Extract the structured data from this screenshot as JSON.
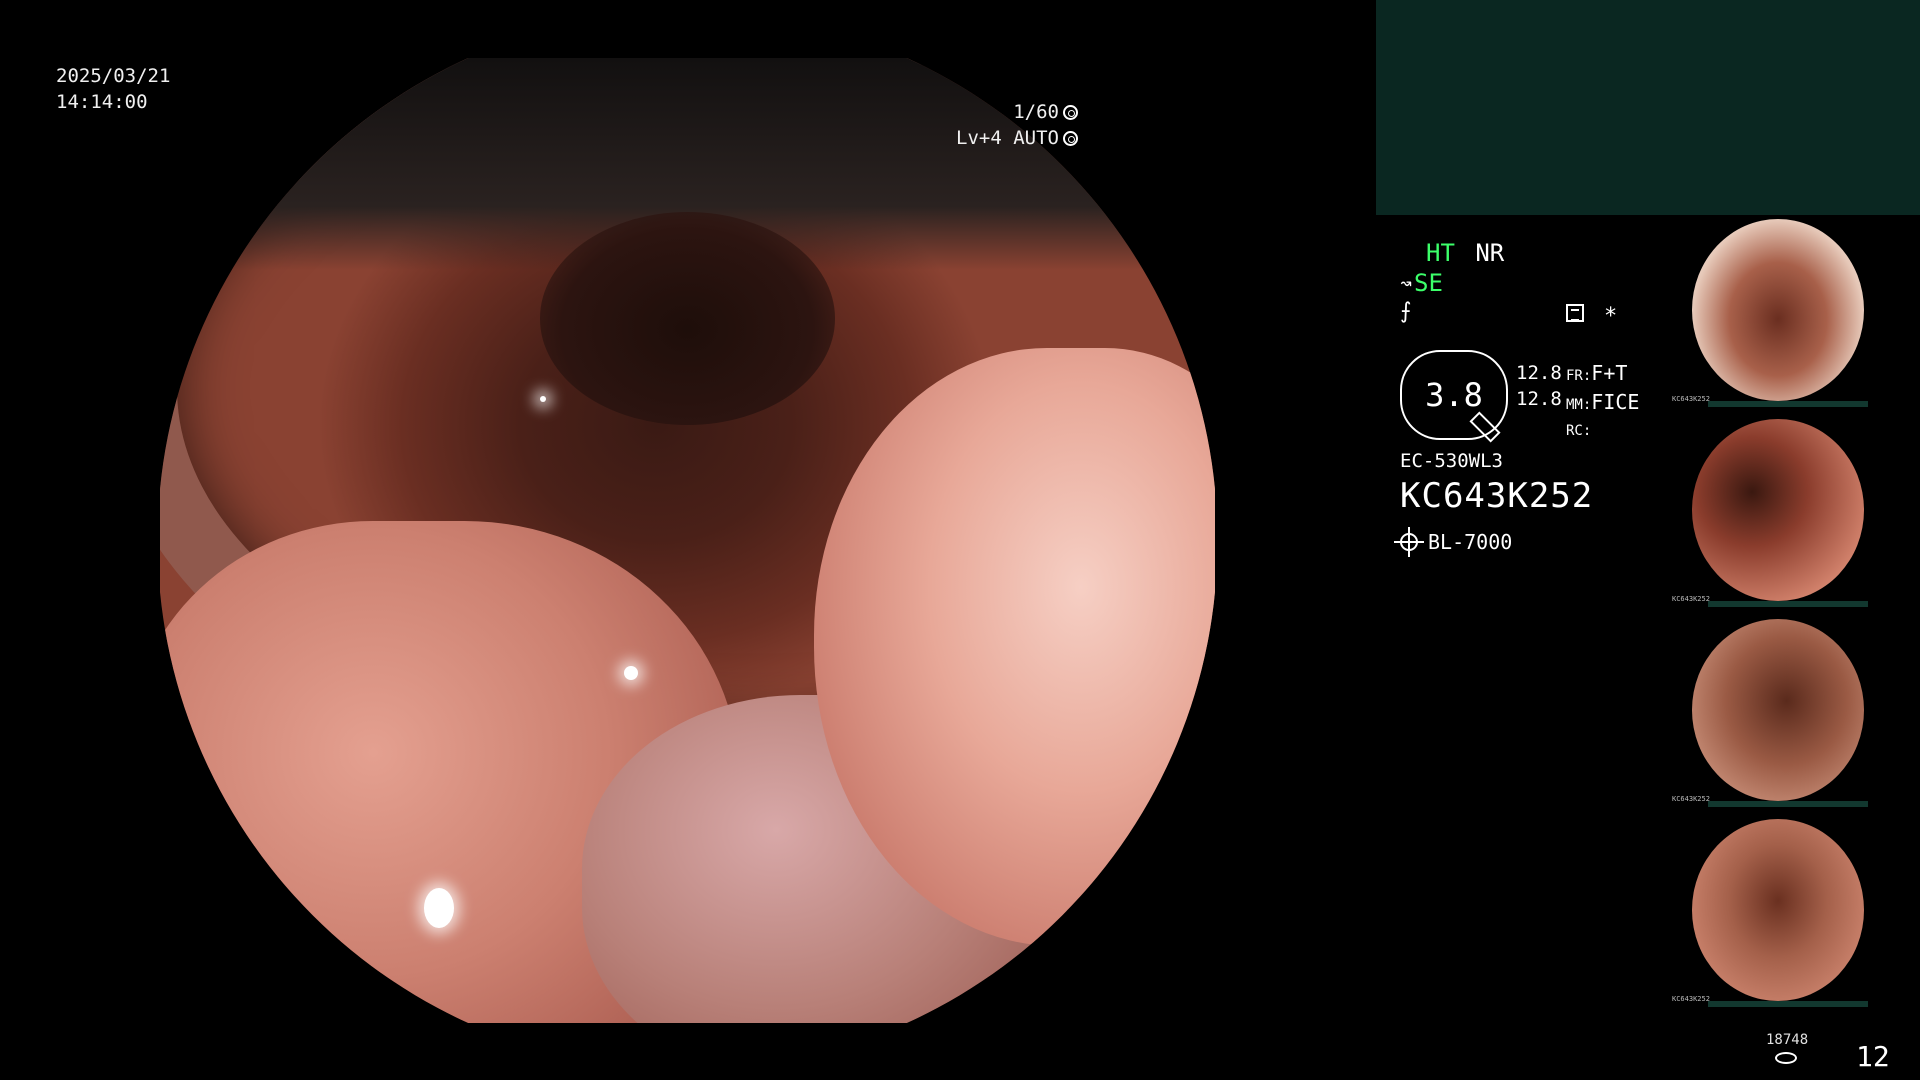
{
  "overlay": {
    "date": "2025/03/21",
    "time": "14:14:00",
    "shutter": "1/60",
    "level": "Lv+4 AUTO"
  },
  "status": {
    "ht": "HT",
    "nr": "NR",
    "se": "SE",
    "gauge_value": "3.8",
    "val1": "12.8",
    "val2": "12.8",
    "fr_label": "FR:",
    "fr_value": "F+T",
    "mm_label": "MM:",
    "mm_value": "FICE",
    "rc_label": "RC:",
    "scope_model": "EC-530WL3",
    "scope_serial": "KC643K252",
    "light_source": "BL-7000"
  },
  "thumbnails": [
    {
      "label": "KC643K252"
    },
    {
      "label": "KC643K252"
    },
    {
      "label": "KC643K252"
    },
    {
      "label": "KC643K252"
    }
  ],
  "counters": {
    "image_count_small": "18748",
    "image_count_big": "12"
  },
  "colors": {
    "accent_green": "#3cff6a",
    "panel_teal": "#0a2721"
  },
  "icons": [
    "shutter-icon",
    "auto-icon",
    "scope-bend-icon",
    "freeze-icon",
    "list-icon",
    "asterisk-icon",
    "light-source-icon",
    "storage-icon"
  ]
}
